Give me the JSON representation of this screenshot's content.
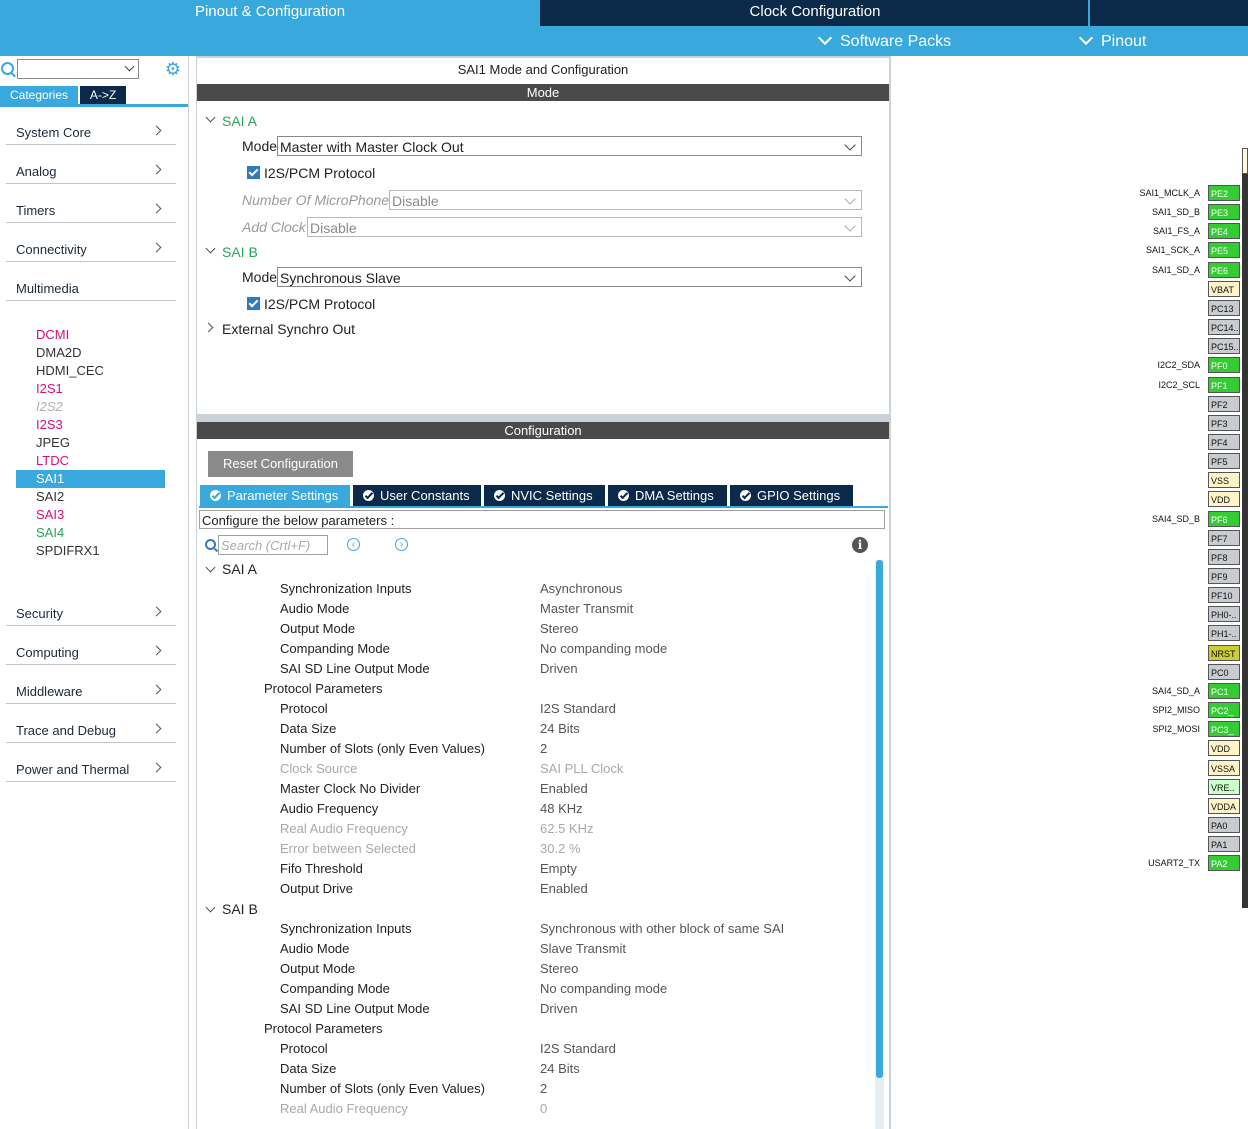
{
  "top_tabs": {
    "pinout": "Pinout & Configuration",
    "clock": "Clock Configuration"
  },
  "sub_menus": {
    "software_packs": "Software Packs",
    "pinout": "Pinout"
  },
  "left": {
    "search": {
      "value": "",
      "placeholder": ""
    },
    "tabs": {
      "categories": "Categories",
      "az": "A->Z"
    },
    "categories": [
      {
        "label": "System Core"
      },
      {
        "label": "Analog"
      },
      {
        "label": "Timers"
      },
      {
        "label": "Connectivity"
      },
      {
        "label": "Multimedia"
      },
      {
        "label": "Security"
      },
      {
        "label": "Computing"
      },
      {
        "label": "Middleware"
      },
      {
        "label": "Trace and Debug"
      },
      {
        "label": "Power and Thermal"
      }
    ],
    "multimedia_items": [
      {
        "label": "DCMI",
        "color": "#d4107a"
      },
      {
        "label": "DMA2D",
        "color": "#333333"
      },
      {
        "label": "HDMI_CEC",
        "color": "#333333"
      },
      {
        "label": "I2S1",
        "color": "#d4107a"
      },
      {
        "label": "I2S2",
        "color": "#b0b0b0"
      },
      {
        "label": "I2S3",
        "color": "#d4107a"
      },
      {
        "label": "JPEG",
        "color": "#333333"
      },
      {
        "label": "LTDC",
        "color": "#d4107a"
      },
      {
        "label": "SAI1",
        "color": "#ffffff"
      },
      {
        "label": "SAI2",
        "color": "#333333"
      },
      {
        "label": "SAI3",
        "color": "#d4107a"
      },
      {
        "label": "SAI4",
        "color": "#2aa15a"
      },
      {
        "label": "SPDIFRX1",
        "color": "#333333"
      }
    ]
  },
  "mode": {
    "title": "SAI1 Mode and Configuration",
    "header": "Mode",
    "sai_a": {
      "label": "SAI A",
      "mode_label": "Mode",
      "mode_value": "Master with Master Clock Out",
      "protocol_label": "I2S/PCM Protocol",
      "mics_label": "Number Of MicroPhones",
      "mics_value": "Disable",
      "clock_label": "Add Clock",
      "clock_value": "Disable"
    },
    "sai_b": {
      "label": "SAI B",
      "mode_label": "Mode",
      "mode_value": "Synchronous Slave",
      "protocol_label": "I2S/PCM Protocol"
    },
    "ext_sync": "External Synchro Out"
  },
  "config": {
    "header": "Configuration",
    "reset_label": "Reset Configuration",
    "tabs": [
      "Parameter Settings",
      "User Constants",
      "NVIC Settings",
      "DMA Settings",
      "GPIO Settings"
    ],
    "hint": "Configure the below parameters :",
    "search_placeholder": "Search (Crtl+F)",
    "info": "i",
    "sai_a_label": "SAI A",
    "sai_b_label": "SAI B",
    "sai_a_params": [
      {
        "name": "Synchronization Inputs",
        "value": "Asynchronous"
      },
      {
        "name": "Audio Mode",
        "value": "Master Transmit"
      },
      {
        "name": "Output Mode",
        "value": "Stereo"
      },
      {
        "name": "Companding Mode",
        "value": "No companding mode"
      },
      {
        "name": "SAI SD Line Output Mode",
        "value": "Driven"
      },
      {
        "group": "Protocol Parameters"
      },
      {
        "name": "Protocol",
        "value": "I2S Standard"
      },
      {
        "name": "Data Size",
        "value": "24 Bits"
      },
      {
        "name": "Number of Slots (only Even Values)",
        "value": "2"
      },
      {
        "name": "Clock Source",
        "value": "SAI PLL Clock",
        "disabled": true
      },
      {
        "name": "Master Clock No Divider",
        "value": "Enabled"
      },
      {
        "name": "Audio Frequency",
        "value": "48 KHz"
      },
      {
        "name": "Real Audio Frequency",
        "value": "62.5 KHz",
        "disabled": true
      },
      {
        "name": "Error between Selected",
        "value": "30.2 %",
        "disabled": true
      },
      {
        "name": "Fifo Threshold",
        "value": "Empty"
      },
      {
        "name": "Output Drive",
        "value": "Enabled"
      }
    ],
    "sai_b_params": [
      {
        "name": "Synchronization Inputs",
        "value": "Synchronous with other block of same SAI"
      },
      {
        "name": "Audio Mode",
        "value": "Slave Transmit"
      },
      {
        "name": "Output Mode",
        "value": "Stereo"
      },
      {
        "name": "Companding Mode",
        "value": "No companding mode"
      },
      {
        "name": "SAI SD Line Output Mode",
        "value": "Driven"
      },
      {
        "group": "Protocol Parameters"
      },
      {
        "name": "Protocol",
        "value": "I2S Standard"
      },
      {
        "name": "Data Size",
        "value": "24 Bits"
      },
      {
        "name": "Number of Slots (only Even Values)",
        "value": "2"
      },
      {
        "name": "Real Audio Frequency",
        "value": "0",
        "disabled": true
      }
    ]
  },
  "pins": [
    {
      "pin": "PE2",
      "label": "SAI1_MCLK_A",
      "color": "#33cc33"
    },
    {
      "pin": "PE3",
      "label": "SAI1_SD_B",
      "color": "#33cc33"
    },
    {
      "pin": "PE4",
      "label": "SAI1_FS_A",
      "color": "#33cc33"
    },
    {
      "pin": "PE5",
      "label": "SAI1_SCK_A",
      "color": "#33cc33"
    },
    {
      "pin": "PE6",
      "label": "SAI1_SD_A",
      "color": "#33cc33"
    },
    {
      "pin": "VBAT",
      "label": "",
      "color": "#fff4c8"
    },
    {
      "pin": "PC13",
      "label": "",
      "color": "#c8ccd0"
    },
    {
      "pin": "PC14..",
      "label": "",
      "color": "#c8ccd0"
    },
    {
      "pin": "PC15..",
      "label": "",
      "color": "#c8ccd0"
    },
    {
      "pin": "PF0",
      "label": "I2C2_SDA",
      "color": "#33cc33"
    },
    {
      "pin": "PF1",
      "label": "I2C2_SCL",
      "color": "#33cc33"
    },
    {
      "pin": "PF2",
      "label": "",
      "color": "#c8ccd0"
    },
    {
      "pin": "PF3",
      "label": "",
      "color": "#c8ccd0"
    },
    {
      "pin": "PF4",
      "label": "",
      "color": "#c8ccd0"
    },
    {
      "pin": "PF5",
      "label": "",
      "color": "#c8ccd0"
    },
    {
      "pin": "VSS",
      "label": "",
      "color": "#fff4c8"
    },
    {
      "pin": "VDD",
      "label": "",
      "color": "#fff4c8"
    },
    {
      "pin": "PF6",
      "label": "SAI4_SD_B",
      "color": "#33cc33"
    },
    {
      "pin": "PF7",
      "label": "",
      "color": "#c8ccd0"
    },
    {
      "pin": "PF8",
      "label": "",
      "color": "#c8ccd0"
    },
    {
      "pin": "PF9",
      "label": "",
      "color": "#c8ccd0"
    },
    {
      "pin": "PF10",
      "label": "",
      "color": "#c8ccd0"
    },
    {
      "pin": "PH0-..",
      "label": "",
      "color": "#c8ccd0"
    },
    {
      "pin": "PH1-..",
      "label": "",
      "color": "#c8ccd0"
    },
    {
      "pin": "NRST",
      "label": "",
      "color": "#cccc33"
    },
    {
      "pin": "PC0",
      "label": "",
      "color": "#c8ccd0"
    },
    {
      "pin": "PC1",
      "label": "SAI4_SD_A",
      "color": "#33cc33"
    },
    {
      "pin": "PC2_",
      "label": "SPI2_MISO",
      "color": "#33cc33"
    },
    {
      "pin": "PC3_",
      "label": "SPI2_MOSI",
      "color": "#33cc33"
    },
    {
      "pin": "VDD",
      "label": "",
      "color": "#fff4c8"
    },
    {
      "pin": "VSSA",
      "label": "",
      "color": "#fff4c8"
    },
    {
      "pin": "VRE..",
      "label": "",
      "color": "#ccffcc"
    },
    {
      "pin": "VDDA",
      "label": "",
      "color": "#fff4c8"
    },
    {
      "pin": "PA0",
      "label": "",
      "color": "#c8ccd0"
    },
    {
      "pin": "PA1",
      "label": "",
      "color": "#c8ccd0"
    },
    {
      "pin": "PA2",
      "label": "USART2_TX",
      "color": "#33cc33"
    }
  ],
  "colors": {
    "accent": "#39a8dc",
    "navy": "#0b2a4a",
    "section_green": "#2aa15a",
    "pink": "#d4107a"
  }
}
